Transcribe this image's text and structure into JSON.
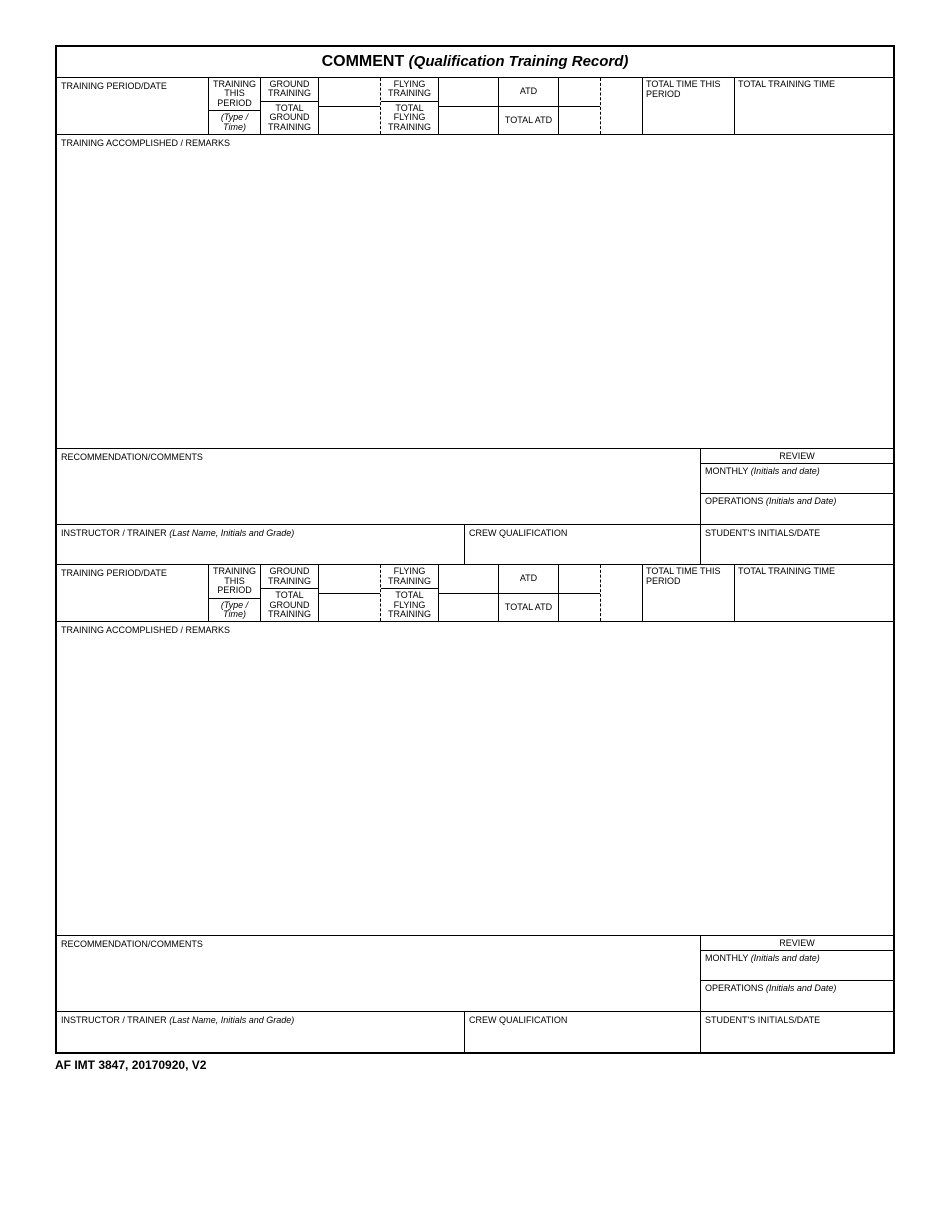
{
  "title": {
    "main": "COMMENT",
    "sub": "(Qualification Training Record)"
  },
  "block": {
    "training_period_date": "TRAINING PERIOD/DATE",
    "training_this_period": "TRAINING THIS PERIOD",
    "type_time": "(Type / Time)",
    "ground_training": "GROUND TRAINING",
    "total_ground_training": "TOTAL GROUND TRAINING",
    "flying_training": "FLYING TRAINING",
    "total_flying_training": "TOTAL FLYING TRAINING",
    "atd": "ATD",
    "total_atd": "TOTAL ATD",
    "total_time_this_period": "TOTAL TIME THIS PERIOD",
    "total_training_time": "TOTAL TRAINING TIME",
    "remarks_label": "TRAINING ACCOMPLISHED / REMARKS",
    "recommendation": "RECOMMENDATION/COMMENTS",
    "review": "REVIEW",
    "monthly": "MONTHLY",
    "monthly_hint": "(Initials and date)",
    "operations": "OPERATIONS",
    "operations_hint": "(Initials and Date)",
    "instructor": "INSTRUCTOR / TRAINER",
    "instructor_hint": "(Last Name, Initials and Grade)",
    "crew_qual": "CREW QUALIFICATION",
    "student": "STUDENT'S INITIALS/DATE"
  },
  "footer": "AF IMT 3847, 20170920, V2"
}
